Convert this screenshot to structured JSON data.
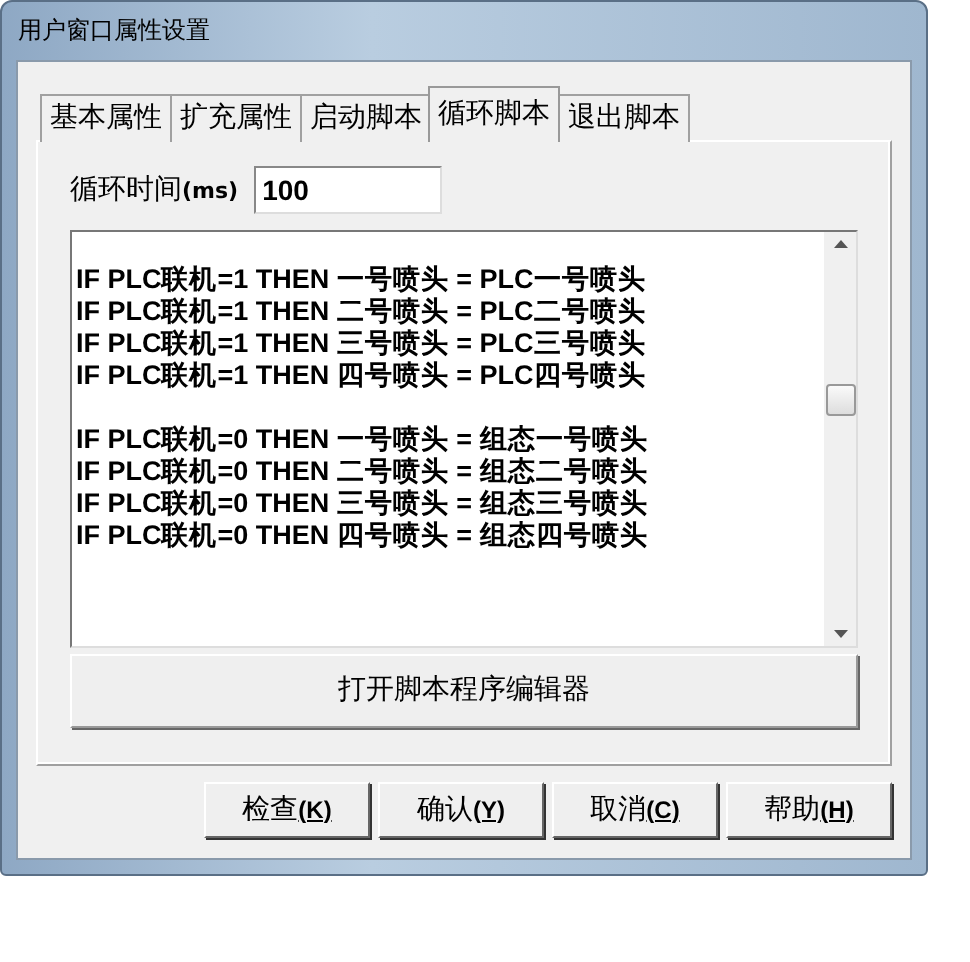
{
  "window": {
    "title": "用户窗口属性设置"
  },
  "tabs": [
    {
      "label": "基本属性",
      "selected": false
    },
    {
      "label": "扩充属性",
      "selected": false
    },
    {
      "label": "启动脚本",
      "selected": false
    },
    {
      "label": "循环脚本",
      "selected": true
    },
    {
      "label": "退出脚本",
      "selected": false
    }
  ],
  "cycle_time": {
    "label": "循环时间**(ms)**",
    "value": "100"
  },
  "script_blocks": [
    [
      "IF PLC联机=1 THEN 一号喷头 = PLC一号喷头",
      "IF PLC联机=1 THEN 二号喷头 = PLC二号喷头",
      "IF PLC联机=1 THEN 三号喷头 = PLC三号喷头",
      "IF PLC联机=1 THEN 四号喷头 = PLC四号喷头"
    ],
    [
      "IF PLC联机=0 THEN 一号喷头 = 组态一号喷头",
      "IF PLC联机=0 THEN 二号喷头 = 组态二号喷头",
      "IF PLC联机=0 THEN 三号喷头 = 组态三号喷头",
      "IF PLC联机=0 THEN 四号喷头 = 组态四号喷头"
    ]
  ],
  "editor_button": "打开脚本程序编辑器",
  "buttons": [
    {
      "label": "检查",
      "key": "(K)"
    },
    {
      "label": "确认",
      "key": "(Y)"
    },
    {
      "label": "取消",
      "key": "(C)"
    },
    {
      "label": "帮助",
      "key": "(H)"
    }
  ]
}
